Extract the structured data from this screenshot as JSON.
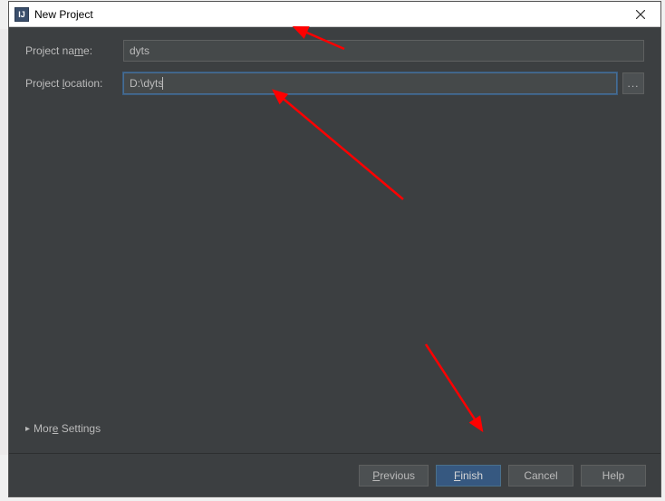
{
  "window": {
    "title": "New Project",
    "icon_label": "IJ"
  },
  "form": {
    "name_label": "Project name:",
    "name_value": "dyts",
    "location_label": "Project location:",
    "location_value": "D:\\dyts",
    "browse_label": "..."
  },
  "more_settings": {
    "label": "More Settings",
    "expanded": false
  },
  "buttons": {
    "previous": "Previous",
    "finish": "Finish",
    "cancel": "Cancel",
    "help": "Help"
  }
}
